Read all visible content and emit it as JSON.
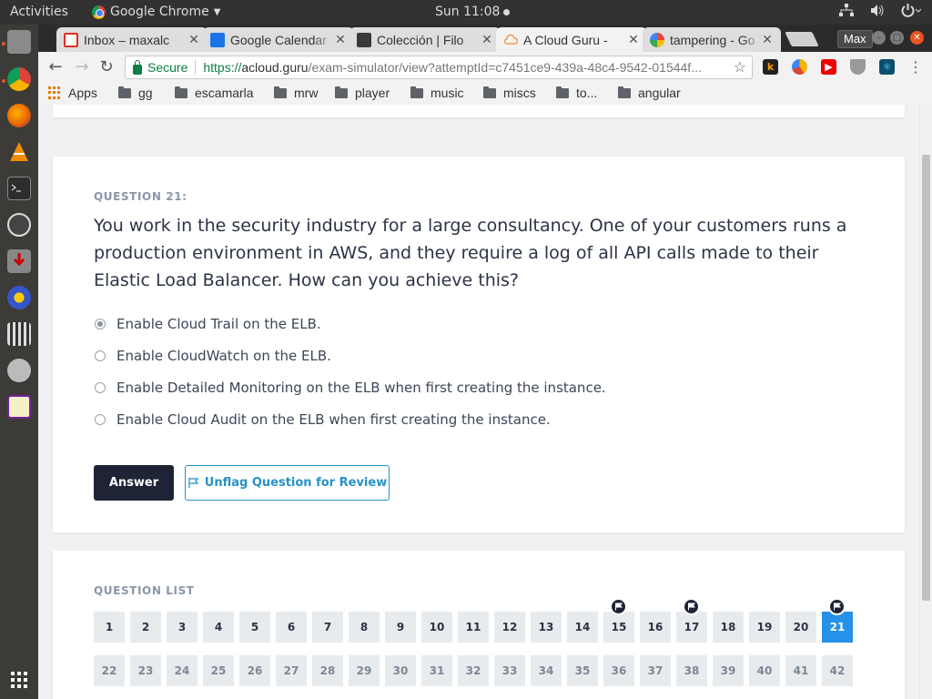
{
  "system": {
    "activities": "Activities",
    "app_name": "Google Chrome",
    "clock": "Sun 11:08",
    "tray_icons": [
      "network-icon",
      "volume-icon",
      "power-icon"
    ]
  },
  "dock": {
    "items": [
      "files-icon",
      "chrome-icon",
      "firefox-icon",
      "vlc-icon",
      "terminal-icon",
      "software-center-icon",
      "download-icon",
      "sound-icon",
      "video-icon",
      "settings-icon",
      "notepad-icon"
    ],
    "show_apps": "show-applications-icon"
  },
  "browser": {
    "tabs": [
      {
        "title": "Inbox – maxalc",
        "icon": "gmail-icon",
        "active": false
      },
      {
        "title": "Google Calendar",
        "icon": "calendar-icon",
        "active": false
      },
      {
        "title": "Colección | Filo",
        "icon": "film-icon",
        "active": false
      },
      {
        "title": "A Cloud Guru - ",
        "icon": "cloud-icon",
        "active": true
      },
      {
        "title": "tampering - Go",
        "icon": "google-icon",
        "active": false
      }
    ],
    "profile": "Max",
    "window_controls": [
      "close",
      "minimize",
      "maximize"
    ],
    "secure_label": "Secure",
    "url_scheme": "https://",
    "url_host": "acloud.guru",
    "url_path": "/exam-simulator/view?attemptId=c7451ce9-439a-48c4-9542-01544f...",
    "extensions": [
      "k-extension-icon",
      "pie-extension-icon",
      "youtube-extension-icon",
      "shield-extension-icon",
      "react-extension-icon"
    ],
    "bookmarks": [
      "Apps",
      "gg",
      "escamarla",
      "mrw",
      "player",
      "music",
      "miscs",
      "to...",
      "angular"
    ]
  },
  "question": {
    "label": "QUESTION 21:",
    "text": "You work in the security industry for a large consultancy. One of your customers runs a production environment in AWS, and they require a log of all API calls made to their Elastic Load Balancer. How can you achieve this?",
    "options": [
      {
        "label": "Enable Cloud Trail on the ELB.",
        "selected": true
      },
      {
        "label": "Enable CloudWatch on the ELB.",
        "selected": false
      },
      {
        "label": "Enable Detailed Monitoring on the ELB when first creating the instance.",
        "selected": false
      },
      {
        "label": "Enable Cloud Audit on the ELB when first creating the instance.",
        "selected": false
      }
    ],
    "answer_button": "Answer",
    "unflag_button": "Unflag Question for Review"
  },
  "question_list": {
    "label": "QUESTION LIST",
    "current": 21,
    "flagged": [
      15,
      17,
      21
    ],
    "visited_through": 21,
    "numbers": [
      "1",
      "2",
      "3",
      "4",
      "5",
      "6",
      "7",
      "8",
      "9",
      "10",
      "11",
      "12",
      "13",
      "14",
      "15",
      "16",
      "17",
      "18",
      "19",
      "20",
      "21",
      "22",
      "23",
      "24",
      "25",
      "26",
      "27",
      "28",
      "29",
      "30",
      "31",
      "32",
      "33",
      "34",
      "35",
      "36",
      "37",
      "38",
      "39",
      "40",
      "41",
      "42"
    ]
  },
  "colors": {
    "accent": "#2691c8",
    "current_question": "#2691e8",
    "dark_button": "#1f2336",
    "secure_green": "#0b8043"
  }
}
